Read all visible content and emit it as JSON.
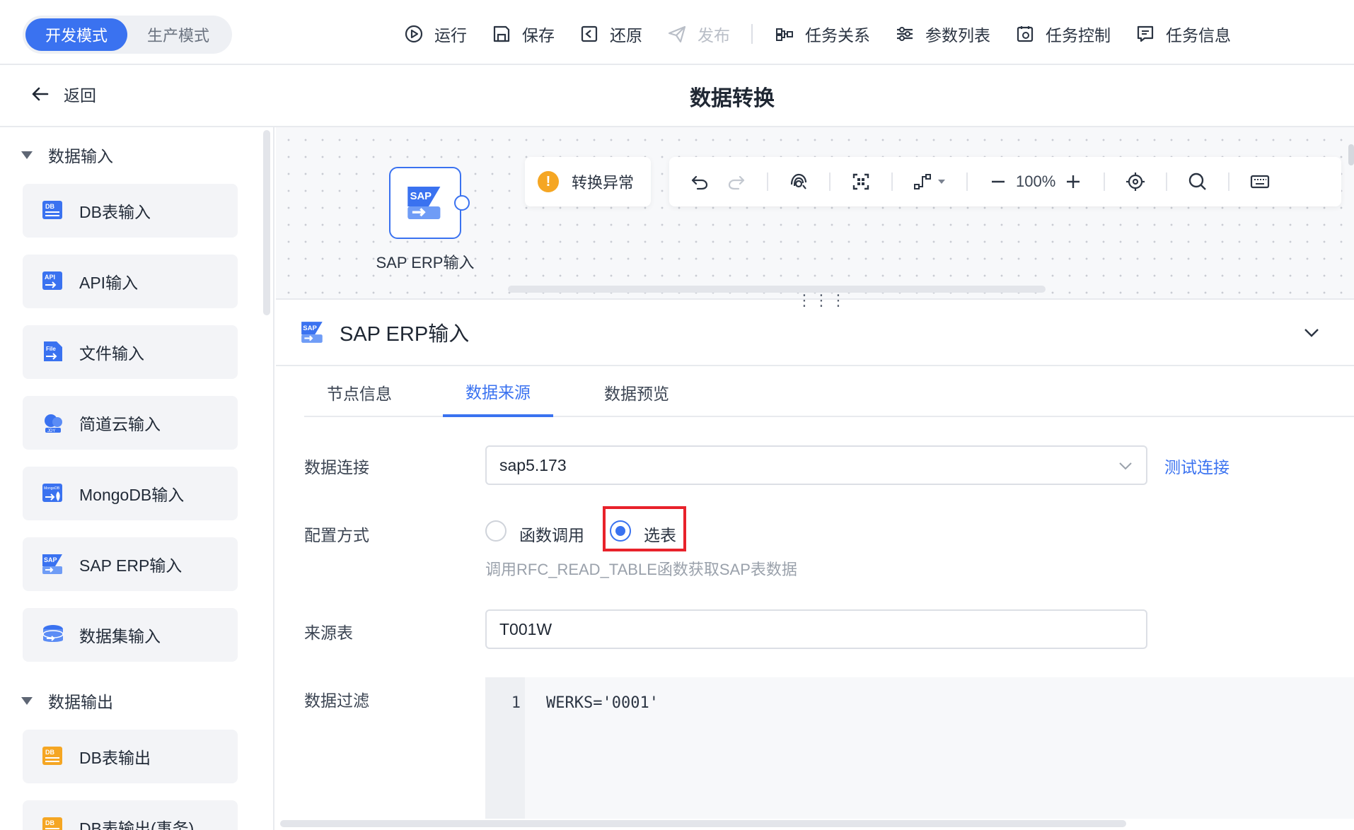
{
  "modes": {
    "dev": "开发模式",
    "prod": "生产模式"
  },
  "toolbar": {
    "run": "运行",
    "save": "保存",
    "restore": "还原",
    "publish": "发布",
    "relations": "任务关系",
    "params": "参数列表",
    "control": "任务控制",
    "info": "任务信息"
  },
  "header": {
    "back": "返回",
    "title": "数据转换"
  },
  "sidebar": {
    "input_group": "数据输入",
    "input_items": [
      "DB表输入",
      "API输入",
      "文件输入",
      "简道云输入",
      "MongoDB输入",
      "SAP ERP输入",
      "数据集输入"
    ],
    "output_group": "数据输出",
    "output_items": [
      "DB表输出",
      "DB表输出(事务)"
    ]
  },
  "canvas": {
    "node_label": "SAP ERP输入",
    "warning": "转换异常",
    "zoom": "100%"
  },
  "panel": {
    "title": "SAP ERP输入",
    "tabs": [
      "节点信息",
      "数据来源",
      "数据预览"
    ],
    "active_tab": "数据来源",
    "labels": {
      "connection": "数据连接",
      "config": "配置方式",
      "source_table": "来源表",
      "filter": "数据过滤"
    },
    "connection_value": "sap5.173",
    "test_link": "测试连接",
    "radio_function": "函数调用",
    "radio_table": "选表",
    "selected_radio": "选表",
    "hint": "调用RFC_READ_TABLE函数获取SAP表数据",
    "source_table_value": "T001W",
    "filter_line_no": "1",
    "filter_code": "WERKS='0001'"
  },
  "colors": {
    "accent": "#3a72f0",
    "warning": "#f5a623",
    "highlight": "#e8222b"
  },
  "icons": [
    "run-icon",
    "save-icon",
    "restore-icon",
    "publish-icon",
    "relations-icon",
    "params-icon",
    "control-icon",
    "info-icon",
    "back-arrow-icon",
    "db-icon",
    "api-icon",
    "file-icon",
    "cloud-icon",
    "mongodb-icon",
    "sap-icon",
    "dataset-icon",
    "undo-icon",
    "redo-icon",
    "fingerprint-icon",
    "fit-view-icon",
    "connector-icon",
    "zoom-out-icon",
    "zoom-in-icon",
    "locate-icon",
    "search-icon",
    "keyboard-icon",
    "chevron-down-icon"
  ]
}
